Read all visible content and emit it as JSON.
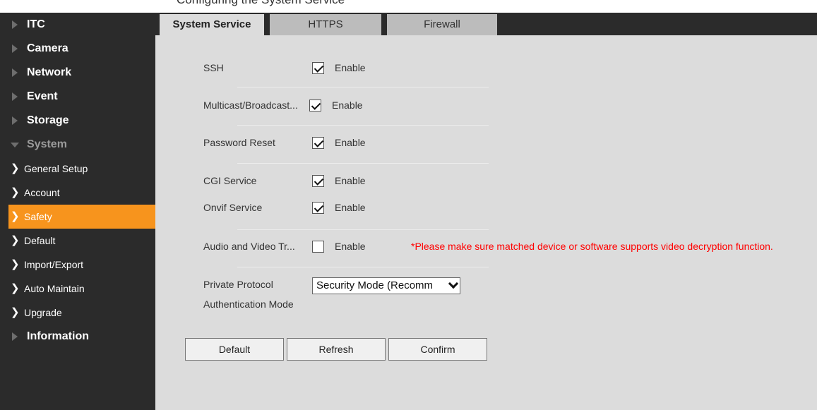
{
  "top_caption": "Configuring the System Service",
  "sidebar": {
    "items": [
      {
        "label": "ITC",
        "type": "top",
        "open": false
      },
      {
        "label": "Camera",
        "type": "top",
        "open": false
      },
      {
        "label": "Network",
        "type": "top",
        "open": false
      },
      {
        "label": "Event",
        "type": "top",
        "open": false
      },
      {
        "label": "Storage",
        "type": "top",
        "open": false
      },
      {
        "label": "System",
        "type": "top",
        "open": true
      },
      {
        "label": "General Setup",
        "type": "sub"
      },
      {
        "label": "Account",
        "type": "sub"
      },
      {
        "label": "Safety",
        "type": "sub",
        "active": true
      },
      {
        "label": "Default",
        "type": "sub"
      },
      {
        "label": "Import/Export",
        "type": "sub"
      },
      {
        "label": "Auto Maintain",
        "type": "sub"
      },
      {
        "label": "Upgrade",
        "type": "sub"
      },
      {
        "label": "Information",
        "type": "top",
        "open": false
      }
    ]
  },
  "tabs": [
    {
      "label": "System Service",
      "active": true
    },
    {
      "label": "HTTPS",
      "active": false
    },
    {
      "label": "Firewall",
      "active": false
    }
  ],
  "settings": {
    "enable_label": "Enable",
    "ssh": {
      "label": "SSH",
      "checked": true
    },
    "multicast": {
      "label": "Multicast/Broadcast...",
      "checked": true
    },
    "password_reset": {
      "label": "Password Reset",
      "checked": true
    },
    "cgi": {
      "label": "CGI Service",
      "checked": true
    },
    "onvif": {
      "label": "Onvif Service",
      "checked": true
    },
    "av_transmission": {
      "label": "Audio and Video Tr...",
      "checked": false
    },
    "warning": "*Please make sure matched device or software supports video decryption function.",
    "private_protocol": {
      "label_line1": "Private Protocol",
      "label_line2": "Authentication Mode",
      "value": "Security Mode (Recomm"
    }
  },
  "buttons": {
    "default": "Default",
    "refresh": "Refresh",
    "confirm": "Confirm"
  },
  "colors": {
    "sidebar_bg": "#2b2b2b",
    "active_item": "#f7941d",
    "content_bg": "#dcdcdc",
    "warning": "#ff0000"
  }
}
